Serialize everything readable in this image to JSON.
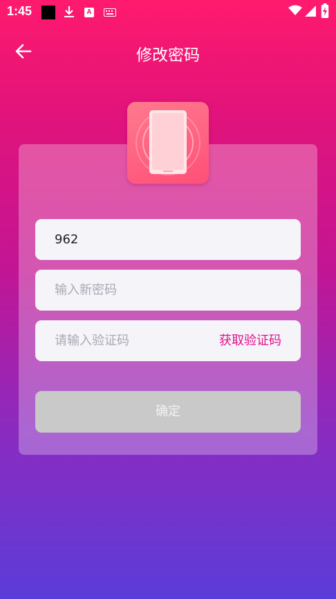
{
  "status_bar": {
    "time": "1:45",
    "a_badge": "A"
  },
  "appbar": {
    "title": "修改密码"
  },
  "form": {
    "phone_value": "962",
    "new_password_placeholder": "输入新密码",
    "code_placeholder": "请输入验证码",
    "get_code_label": "获取验证码",
    "confirm_label": "确定"
  },
  "colors": {
    "accent": "#e0148a",
    "button_disabled": "#c9c9c9"
  }
}
